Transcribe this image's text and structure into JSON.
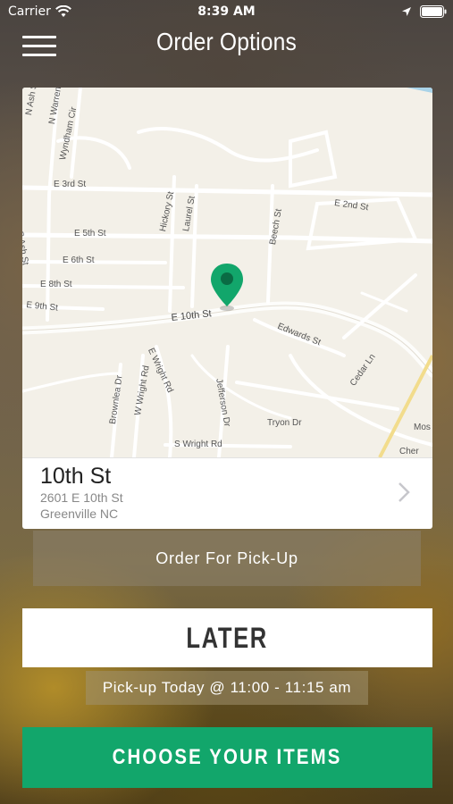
{
  "status_bar": {
    "carrier": "Carrier",
    "time": "8:39 AM",
    "wifi_icon": "wifi-icon",
    "location_icon": "location-arrow-icon",
    "battery_icon": "battery-icon"
  },
  "header": {
    "title": "Order Options",
    "menu_icon": "hamburger-menu-icon"
  },
  "map": {
    "pin_icon": "map-pin-icon",
    "pin_color": "#12a66b",
    "streets": [
      "N Ash St",
      "N Warren St",
      "Wyndham Cir",
      "E 3rd St",
      "S Ash St",
      "Hickory St",
      "Laurel St",
      "E 2nd St",
      "Beech St",
      "E 5th St",
      "E 6th St",
      "E 8th St",
      "E 9th St",
      "E 10th St",
      "Edwards St",
      "Cedar Ln",
      "E Wright Rd",
      "Brownlea Dr",
      "W Wright Rd",
      "Jefferson Dr",
      "Tryon Dr",
      "S Wright Rd",
      "Mos",
      "Cher"
    ]
  },
  "location": {
    "name": "10th St",
    "address": "2601 E 10th St",
    "city": "Greenville NC",
    "chevron_icon": "chevron-right-icon"
  },
  "order_type_label": "Order For Pick-Up",
  "timing": {
    "label": "LATER",
    "pickup_time": "Pick-up Today @ 11:00 - 11:15 am"
  },
  "primary_action": {
    "label": "CHOOSE YOUR ITEMS",
    "color": "#12a66b"
  }
}
